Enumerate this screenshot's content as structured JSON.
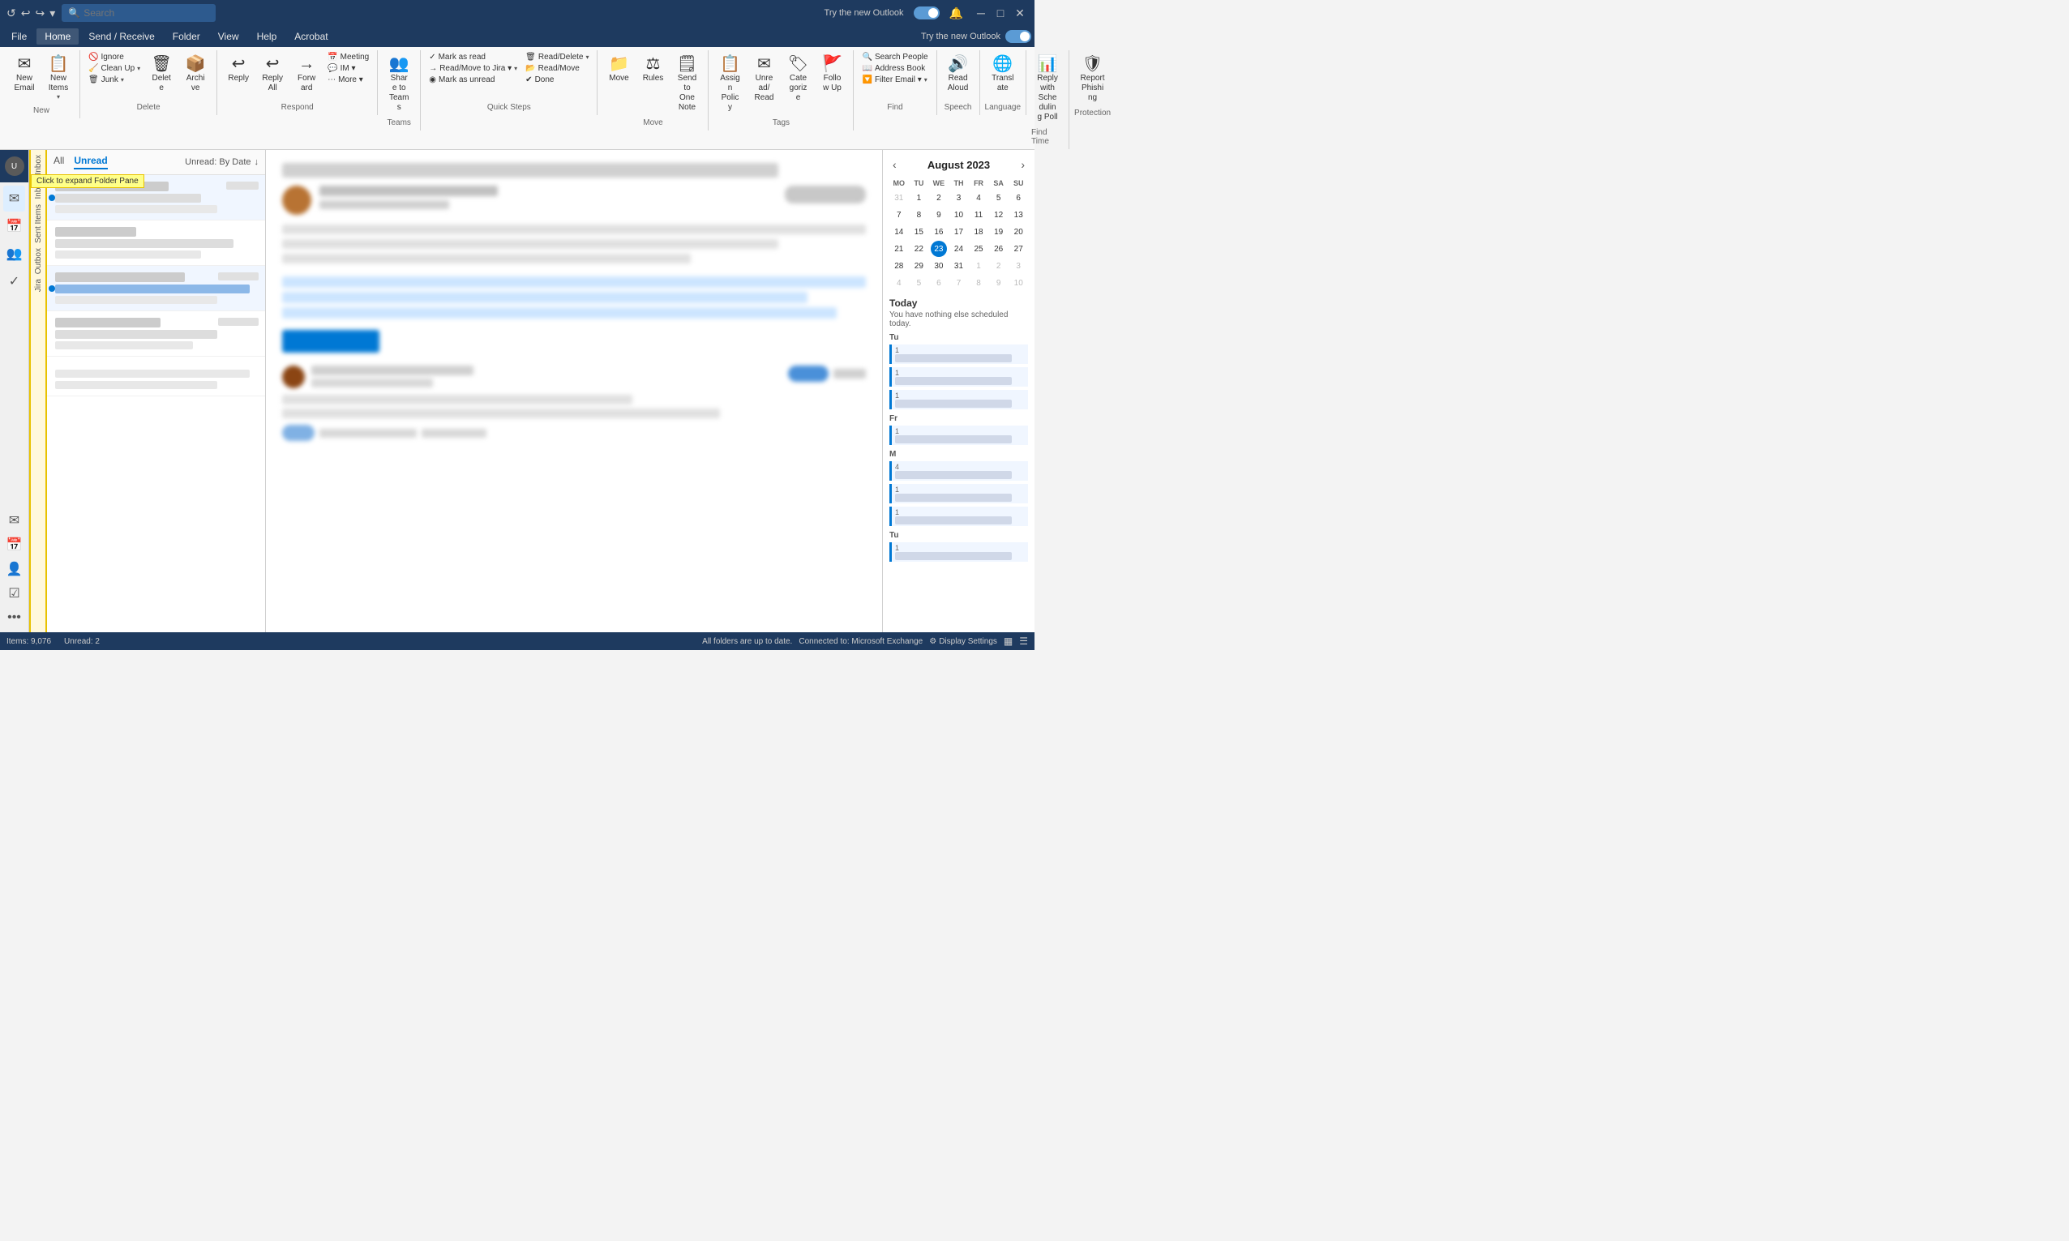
{
  "titleBar": {
    "searchPlaceholder": "Search",
    "tryNew": "Try the new Outlook",
    "toggleState": "on"
  },
  "menuBar": {
    "items": [
      {
        "id": "file",
        "label": "File"
      },
      {
        "id": "home",
        "label": "Home",
        "active": true
      },
      {
        "id": "sendReceive",
        "label": "Send / Receive"
      },
      {
        "id": "folder",
        "label": "Folder"
      },
      {
        "id": "view",
        "label": "View"
      },
      {
        "id": "help",
        "label": "Help"
      },
      {
        "id": "acrobat",
        "label": "Acrobat"
      }
    ]
  },
  "ribbon": {
    "groups": [
      {
        "id": "new",
        "label": "New",
        "buttons": [
          {
            "id": "new-email",
            "icon": "✉",
            "label": "New Email"
          },
          {
            "id": "new-items",
            "icon": "📋",
            "label": "New Items",
            "dropdown": true
          }
        ]
      },
      {
        "id": "delete",
        "label": "Delete",
        "buttons": [
          {
            "id": "ignore",
            "icon": "🚫",
            "label": "Ignore",
            "small": true
          },
          {
            "id": "clean-up",
            "icon": "🧹",
            "label": "Clean Up",
            "small": true,
            "dropdown": true
          },
          {
            "id": "junk",
            "icon": "🗑",
            "label": "Junk",
            "small": true,
            "dropdown": true
          },
          {
            "id": "delete",
            "icon": "🗑",
            "label": "Delete",
            "large": true
          },
          {
            "id": "archive",
            "icon": "📦",
            "label": "Archive",
            "large": true
          }
        ]
      },
      {
        "id": "respond",
        "label": "Respond",
        "buttons": [
          {
            "id": "reply",
            "icon": "↩",
            "label": "Reply"
          },
          {
            "id": "reply-all",
            "icon": "↩↩",
            "label": "Reply All"
          },
          {
            "id": "forward",
            "icon": "→",
            "label": "Forward"
          },
          {
            "id": "meeting",
            "icon": "📅",
            "label": "Meeting",
            "small": true
          },
          {
            "id": "im",
            "icon": "💬",
            "label": "IM ▾",
            "small": true,
            "dropdown": true
          },
          {
            "id": "more",
            "icon": "•••",
            "label": "More ▾",
            "small": true,
            "dropdown": true
          }
        ]
      },
      {
        "id": "teams",
        "label": "Teams",
        "buttons": [
          {
            "id": "share-teams",
            "icon": "👥",
            "label": "Share to Teams"
          }
        ]
      },
      {
        "id": "quick-steps",
        "label": "Quick Steps",
        "buttons": [
          {
            "id": "mark-as-read",
            "icon": "✓",
            "label": "Mark as read",
            "small": true
          },
          {
            "id": "read-move-jira",
            "icon": "→",
            "label": "Read/Move to Jira ▾",
            "small": true,
            "dropdown": true
          },
          {
            "id": "mark-as-unread",
            "icon": "◉",
            "label": "Mark as unread",
            "small": true
          },
          {
            "id": "read-delete",
            "icon": "🗑",
            "label": "Read/Delete",
            "small": true,
            "dropdown": true
          },
          {
            "id": "read-move",
            "icon": "📂",
            "label": "Read/Move",
            "small": true
          },
          {
            "id": "done",
            "icon": "✔",
            "label": "Done",
            "small": true
          }
        ]
      },
      {
        "id": "move",
        "label": "Move",
        "buttons": [
          {
            "id": "move-btn",
            "icon": "📁",
            "label": "Move"
          },
          {
            "id": "rules",
            "icon": "⚖",
            "label": "Rules"
          },
          {
            "id": "send-to-onenote",
            "icon": "🗒",
            "label": "Send to OneNote"
          }
        ]
      },
      {
        "id": "tags",
        "label": "Tags",
        "buttons": [
          {
            "id": "assign-policy",
            "icon": "📋",
            "label": "Assign Policy"
          },
          {
            "id": "unread-read",
            "icon": "✉",
            "label": "Unread/ Read"
          },
          {
            "id": "categorize",
            "icon": "🏷",
            "label": "Categorize"
          },
          {
            "id": "follow-up",
            "icon": "🚩",
            "label": "Follow Up"
          }
        ]
      },
      {
        "id": "find",
        "label": "Find",
        "buttons": [
          {
            "id": "search-people",
            "icon": "🔍",
            "label": "Search People",
            "small": true
          },
          {
            "id": "address-book",
            "icon": "📖",
            "label": "Address Book",
            "small": true
          },
          {
            "id": "filter-email",
            "icon": "🔽",
            "label": "Filter Email ▾",
            "small": true,
            "dropdown": true
          }
        ]
      },
      {
        "id": "speech",
        "label": "Speech",
        "buttons": [
          {
            "id": "read-aloud",
            "icon": "🔊",
            "label": "Read Aloud"
          }
        ]
      },
      {
        "id": "language",
        "label": "Language",
        "buttons": [
          {
            "id": "translate",
            "icon": "🌐",
            "label": "Translate"
          }
        ]
      },
      {
        "id": "find-time",
        "label": "Find Time",
        "buttons": [
          {
            "id": "reply-scheduling-poll",
            "icon": "📊",
            "label": "Reply with Scheduling Poll"
          }
        ]
      },
      {
        "id": "protection",
        "label": "Protection",
        "buttons": [
          {
            "id": "report-phishing",
            "icon": "🛡",
            "label": "Report Phishing"
          }
        ]
      }
    ]
  },
  "emailList": {
    "tabs": [
      {
        "id": "all",
        "label": "All"
      },
      {
        "id": "unread",
        "label": "Unread",
        "active": true
      }
    ],
    "sortLabel": "Unread: By Date",
    "items": [
      {
        "id": 1,
        "sender": "████████ ██████",
        "subject": "██████ ██ ████",
        "preview": "██████████████████████",
        "date": "██/██",
        "unread": true
      },
      {
        "id": 2,
        "sender": "████████████",
        "subject": "████ ██ █████ ███████",
        "preview": "███████████████",
        "date": "",
        "unread": false
      },
      {
        "id": 3,
        "sender": "████████████████████",
        "subject": "██████████████████████████████████████████████████",
        "preview": "████████████████████████",
        "date": "██/██/██",
        "unread": true
      },
      {
        "id": 4,
        "sender": "████████ ████████████",
        "subject": "████████████ ██████ ██████████████",
        "preview": "████████████████████",
        "date": "██/██/██",
        "unread": false
      }
    ]
  },
  "readingPane": {
    "subject": "████████████████████████████████████████████████████████████████████████████████████████████",
    "sender": "████████ █████████ ██████",
    "to": "████████████",
    "date": "██████ ██, ████ ██:██ ██",
    "bodyLines": [
      {
        "type": "full"
      },
      {
        "type": "med"
      },
      {
        "type": "full"
      },
      {
        "type": "short"
      }
    ],
    "ctaButton": "████████████",
    "footerText": "████████████████████████████████████████████████████"
  },
  "calendarPanel": {
    "month": "August 2023",
    "dayHeaders": [
      "MO",
      "TU",
      "WE",
      "TH",
      "FR",
      "SA",
      "SU"
    ],
    "weeks": [
      [
        {
          "day": "31",
          "otherMonth": true
        },
        {
          "day": "1"
        },
        {
          "day": "2"
        },
        {
          "day": "3"
        },
        {
          "day": "4"
        },
        {
          "day": "5"
        },
        {
          "day": "6"
        }
      ],
      [
        {
          "day": "7"
        },
        {
          "day": "8"
        },
        {
          "day": "9"
        },
        {
          "day": "10"
        },
        {
          "day": "11"
        },
        {
          "day": "12"
        },
        {
          "day": "13"
        }
      ],
      [
        {
          "day": "14"
        },
        {
          "day": "15"
        },
        {
          "day": "16"
        },
        {
          "day": "17"
        },
        {
          "day": "18"
        },
        {
          "day": "19"
        },
        {
          "day": "20"
        }
      ],
      [
        {
          "day": "21"
        },
        {
          "day": "22"
        },
        {
          "day": "23",
          "today": true
        },
        {
          "day": "24"
        },
        {
          "day": "25"
        },
        {
          "day": "26"
        },
        {
          "day": "27"
        }
      ],
      [
        {
          "day": "28"
        },
        {
          "day": "29"
        },
        {
          "day": "30"
        },
        {
          "day": "31"
        },
        {
          "day": "1",
          "otherMonth": true
        },
        {
          "day": "2",
          "otherMonth": true
        },
        {
          "day": "3",
          "otherMonth": true
        }
      ],
      [
        {
          "day": "4",
          "otherMonth": true
        },
        {
          "day": "5",
          "otherMonth": true
        },
        {
          "day": "6",
          "otherMonth": true
        },
        {
          "day": "7",
          "otherMonth": true
        },
        {
          "day": "8",
          "otherMonth": true
        },
        {
          "day": "9",
          "otherMonth": true
        },
        {
          "day": "10",
          "otherMonth": true
        }
      ]
    ],
    "todayLabel": "Today",
    "todayMessage": "You have nothing else scheduled today.",
    "scheduleItems": [
      {
        "time": "Tu",
        "color": "#0078d4"
      },
      {
        "time": "Fr",
        "color": "#0078d4"
      },
      {
        "time": "M",
        "color": "#0078d4"
      },
      {
        "time": "Tu",
        "color": "#0078d4"
      }
    ]
  },
  "sidebarNav": {
    "items": [
      {
        "id": "mail",
        "icon": "✉",
        "label": "Mail",
        "active": true
      },
      {
        "id": "calendar",
        "icon": "📅",
        "label": "Calendar"
      },
      {
        "id": "people",
        "icon": "👥",
        "label": "People"
      },
      {
        "id": "tasks",
        "icon": "✓",
        "label": "Tasks"
      }
    ],
    "more": "•••"
  },
  "folderPane": {
    "tooltip": "Click to expand Folder Pane",
    "items": [
      "Inbox",
      "Inbox",
      "Sent Items",
      "Outbox",
      "Jira"
    ]
  },
  "statusBar": {
    "items": "Items: 9,076",
    "unread": "Unread: 2",
    "sync": "All folders are up to date.",
    "connection": "Connected to: Microsoft Exchange",
    "displaySettings": "Display Settings"
  }
}
